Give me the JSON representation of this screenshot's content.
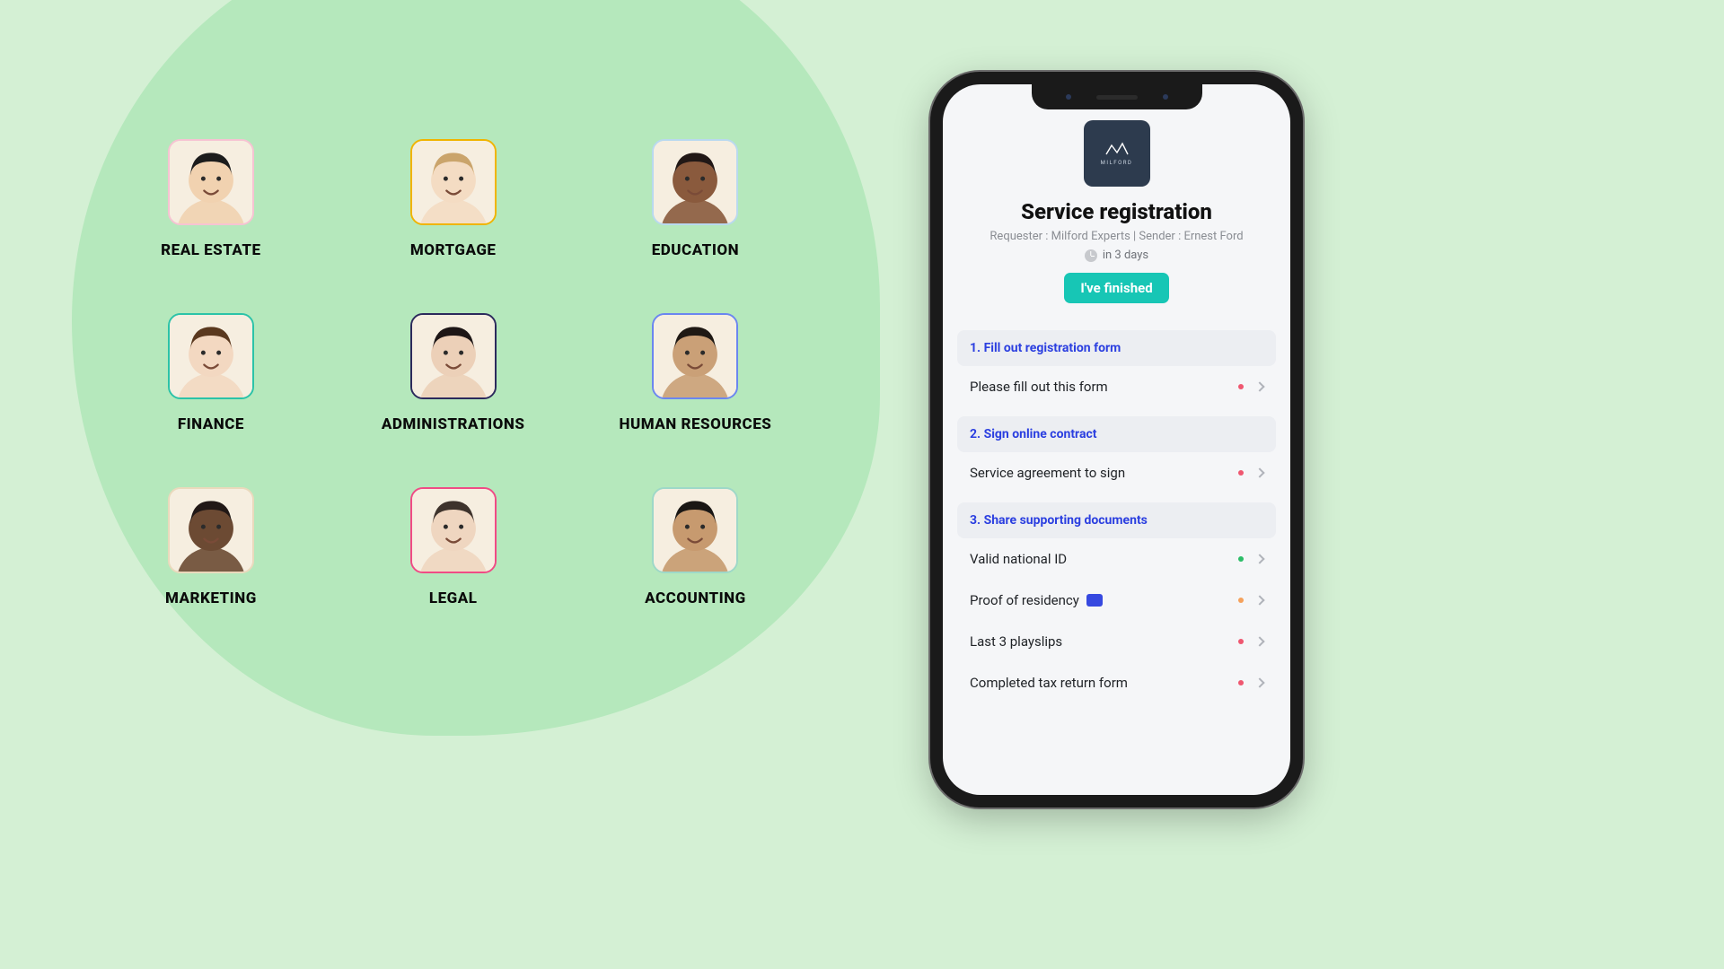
{
  "categories": [
    {
      "label": "REAL ESTATE",
      "border": "av-pink",
      "skin": "#f1d2b0",
      "hair": "#1c1c1c"
    },
    {
      "label": "MORTGAGE",
      "border": "av-yellow",
      "skin": "#f4dcc3",
      "hair": "#caa46b"
    },
    {
      "label": "EDUCATION",
      "border": "av-ltblue",
      "skin": "#8a5a3d",
      "hair": "#211816"
    },
    {
      "label": "FINANCE",
      "border": "av-teal",
      "skin": "#f3d8c1",
      "hair": "#5a381e"
    },
    {
      "label": "ADMINISTRATIONS",
      "border": "av-indigo",
      "skin": "#ecd0b8",
      "hair": "#1d1616"
    },
    {
      "label": "HUMAN RESOURCES",
      "border": "av-blue",
      "skin": "#caa077",
      "hair": "#1f1914"
    },
    {
      "label": "MARKETING",
      "border": "av-beige",
      "skin": "#6c4a33",
      "hair": "#211816"
    },
    {
      "label": "LEGAL",
      "border": "av-hotpink",
      "skin": "#efd6c0",
      "hair": "#3e332c"
    },
    {
      "label": "ACCOUNTING",
      "border": "av-mint",
      "skin": "#c79a6f",
      "hair": "#1a1715"
    }
  ],
  "phone": {
    "logo_text": "MILFORD",
    "title": "Service registration",
    "meta": "Requester : Milford Experts | Sender : Ernest Ford",
    "due": "in 3 days",
    "finish_label": "I've finished",
    "sections": [
      {
        "header": "1. Fill out registration form",
        "items": [
          {
            "label": "Please fill out this form",
            "status": "s-red",
            "comment": false
          }
        ]
      },
      {
        "header": "2. Sign online contract",
        "items": [
          {
            "label": "Service agreement to sign",
            "status": "s-red",
            "comment": false
          }
        ]
      },
      {
        "header": "3. Share supporting documents",
        "items": [
          {
            "label": "Valid national ID",
            "status": "s-green",
            "comment": false
          },
          {
            "label": "Proof of residency",
            "status": "s-orange",
            "comment": true
          },
          {
            "label": "Last 3 playslips",
            "status": "s-red",
            "comment": false
          },
          {
            "label": "Completed tax return form",
            "status": "s-red",
            "comment": false
          }
        ]
      }
    ]
  }
}
